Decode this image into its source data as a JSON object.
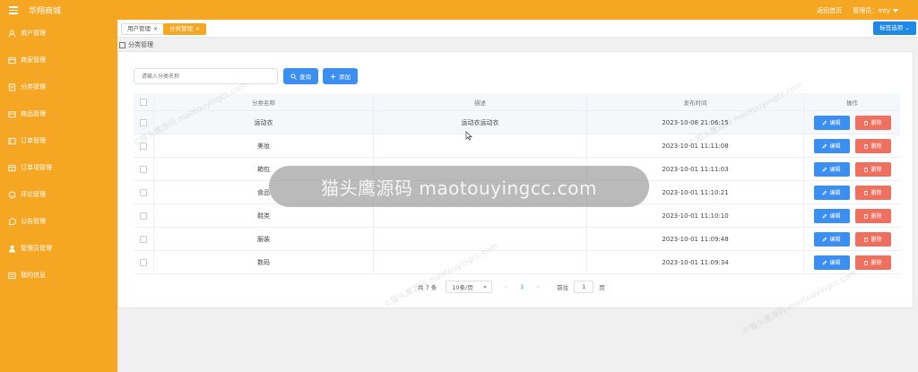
{
  "app": {
    "brand": "华翔商城",
    "home_link": "返回首页",
    "admin_label": "管理员：mty"
  },
  "sidebar": {
    "items": [
      {
        "label": "用户管理",
        "icon": "user-icon"
      },
      {
        "label": "商家管理",
        "icon": "store-icon"
      },
      {
        "label": "分类管理",
        "icon": "category-icon"
      },
      {
        "label": "商品管理",
        "icon": "goods-icon"
      },
      {
        "label": "订单管理",
        "icon": "order-icon"
      },
      {
        "label": "订单项管理",
        "icon": "order-item-icon"
      },
      {
        "label": "评论管理",
        "icon": "comment-icon"
      },
      {
        "label": "公告管理",
        "icon": "notice-icon"
      },
      {
        "label": "管理员管理",
        "icon": "admin-icon"
      },
      {
        "label": "我的信息",
        "icon": "profile-icon"
      }
    ]
  },
  "tabs": [
    {
      "label": "用户管理",
      "close": "×",
      "active": false
    },
    {
      "label": "分类管理",
      "close": "×",
      "active": true
    }
  ],
  "tab_options_label": "标签选项",
  "page_title": "分类管理",
  "search": {
    "placeholder": "请输入分类名称",
    "query_label": "查询",
    "add_label": "添加"
  },
  "table": {
    "headers": {
      "name": "分类名称",
      "desc": "描述",
      "time": "发布时间",
      "ops": "操作"
    },
    "rows": [
      {
        "name": "运动衣",
        "desc": "运动衣运动衣",
        "time": "2023-10-08 21:06:15"
      },
      {
        "name": "美妆",
        "desc": "",
        "time": "2023-10-01 11:11:08"
      },
      {
        "name": "箱包",
        "desc": "",
        "time": "2023-10-01 11:11:03"
      },
      {
        "name": "食品",
        "desc": "",
        "time": "2023-10-01 11:10:21"
      },
      {
        "name": "鞋类",
        "desc": "",
        "time": "2023-10-01 11:10:10"
      },
      {
        "name": "服装",
        "desc": "",
        "time": "2023-10-01 11:09:48"
      },
      {
        "name": "数码",
        "desc": "",
        "time": "2023-10-01 11:09:34"
      }
    ],
    "edit_label": "编辑",
    "delete_label": "删除"
  },
  "pagination": {
    "total": "共 7 条",
    "page_size": "10条/页",
    "prev": "‹",
    "current": "1",
    "next": "›",
    "goto_label": "前往",
    "goto_value": "1",
    "page_suffix": "页"
  },
  "watermark": {
    "overlay_text": "猫头鹰源码 maotouyingcc.com",
    "tile_text": "©猫头鹰源码 maotouyingcc.com"
  },
  "colors": {
    "brand_orange": "#f5a623",
    "primary_blue": "#3b8ff3",
    "danger_red": "#f0705f"
  }
}
